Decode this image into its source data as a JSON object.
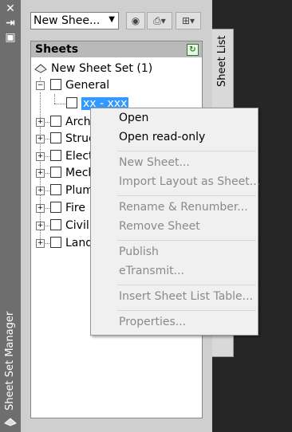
{
  "palette": {
    "title": "Sheet Set Manager",
    "tab": "Sheet List"
  },
  "left_strip": {
    "close_glyph": "✕",
    "pin_glyph": "⇥",
    "menu_glyph": "▣"
  },
  "toolbar": {
    "dropdown_value": "New Shee...",
    "dropdown_arrow": "▼",
    "btn1_glyph": "◉",
    "btn2_glyph": "⎙▾",
    "btn3_glyph": "⊞▾"
  },
  "tree": {
    "header": "Sheets",
    "refresh_glyph": "↻",
    "sheet_set": "New Sheet Set (1)",
    "general": "General",
    "selected_sheet": "xx - xxx",
    "subsets": [
      "Arch",
      "Struc",
      "Elect",
      "Mech",
      "Plum",
      "Fire",
      "Civil",
      "Land"
    ],
    "collapse_glyph": "−",
    "expand_glyph": "+"
  },
  "context_menu": {
    "items": [
      {
        "label": "Open",
        "enabled": true
      },
      {
        "label": "Open read-only",
        "enabled": true
      },
      {
        "label": "New Sheet...",
        "enabled": false
      },
      {
        "label": "Import Layout as Sheet...",
        "enabled": false
      },
      {
        "label": "Rename & Renumber...",
        "enabled": false
      },
      {
        "label": "Remove Sheet",
        "enabled": false
      },
      {
        "label": "Publish",
        "enabled": false
      },
      {
        "label": "eTransmit...",
        "enabled": false
      },
      {
        "label": "Insert Sheet List Table...",
        "enabled": false
      },
      {
        "label": "Properties...",
        "enabled": false
      }
    ]
  },
  "colors": {
    "selection": "#3399ff",
    "disabled_text": "#8a8a8a",
    "palette_bg": "#cfcfcf"
  }
}
